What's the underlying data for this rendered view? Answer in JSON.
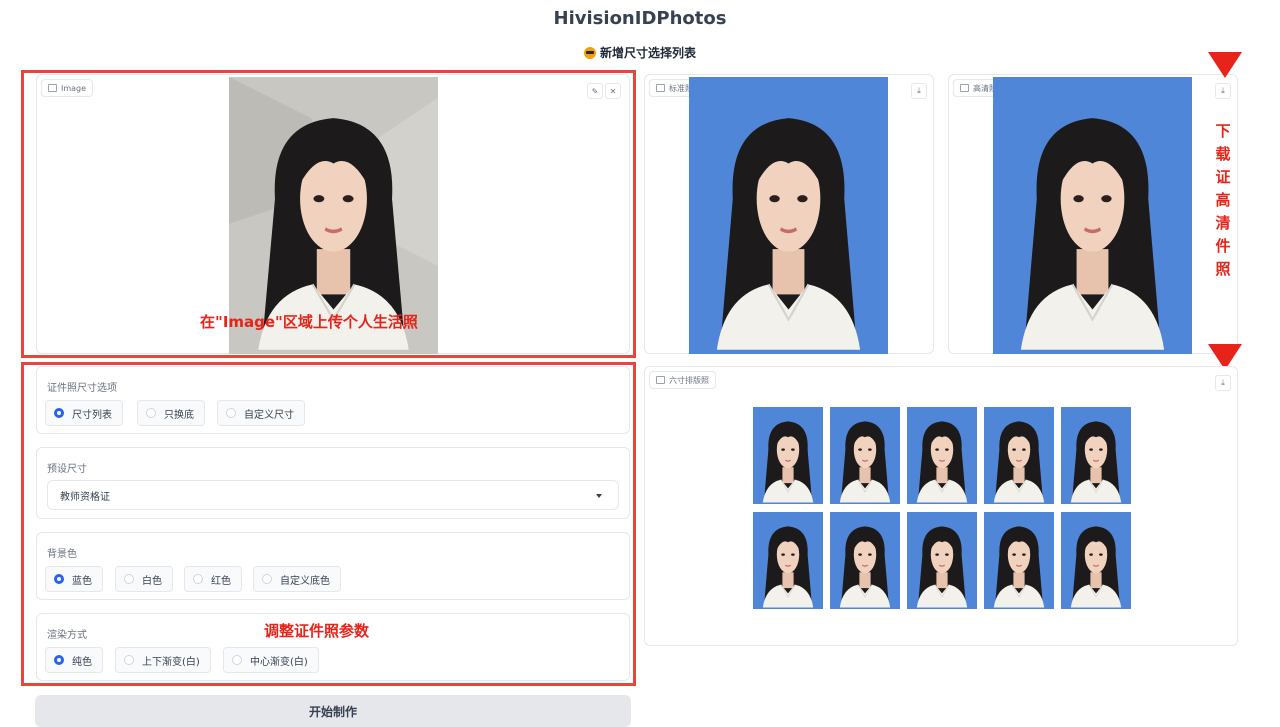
{
  "header": {
    "title": "HivisionIDPhotos",
    "subtitle": "新增尺寸选择列表"
  },
  "input_panel": {
    "label": "Image",
    "annotation": "在\"Image\"区域上传个人生活照"
  },
  "output": {
    "standard_label": "标准照",
    "hd_label": "高清照",
    "layout_label": "六寸排版照",
    "download_annotation": [
      "下",
      "载",
      "证",
      "高",
      "清",
      "件",
      "照"
    ]
  },
  "params": {
    "size_option": {
      "label": "证件照尺寸选项",
      "options": [
        "尺寸列表",
        "只换底",
        "自定义尺寸"
      ],
      "selected": "尺寸列表"
    },
    "preset_size": {
      "label": "预设尺寸",
      "value": "教师资格证"
    },
    "background": {
      "label": "背景色",
      "options": [
        "蓝色",
        "白色",
        "红色",
        "自定义底色"
      ],
      "selected": "蓝色"
    },
    "render": {
      "label": "渲染方式",
      "options": [
        "纯色",
        "上下渐变(白)",
        "中心渐变(白)"
      ],
      "selected": "纯色"
    },
    "annotation": "调整证件照参数"
  },
  "actions": {
    "start_label": "开始制作"
  },
  "icons": {
    "image_icon": "image-icon",
    "edit_icon": "pencil-icon",
    "close_icon": "close-icon",
    "download_icon": "download-icon"
  },
  "colors": {
    "annotation_red": "#e8231a",
    "photo_blue_bg": "#4f86d8",
    "selected_radio": "#2563eb"
  }
}
